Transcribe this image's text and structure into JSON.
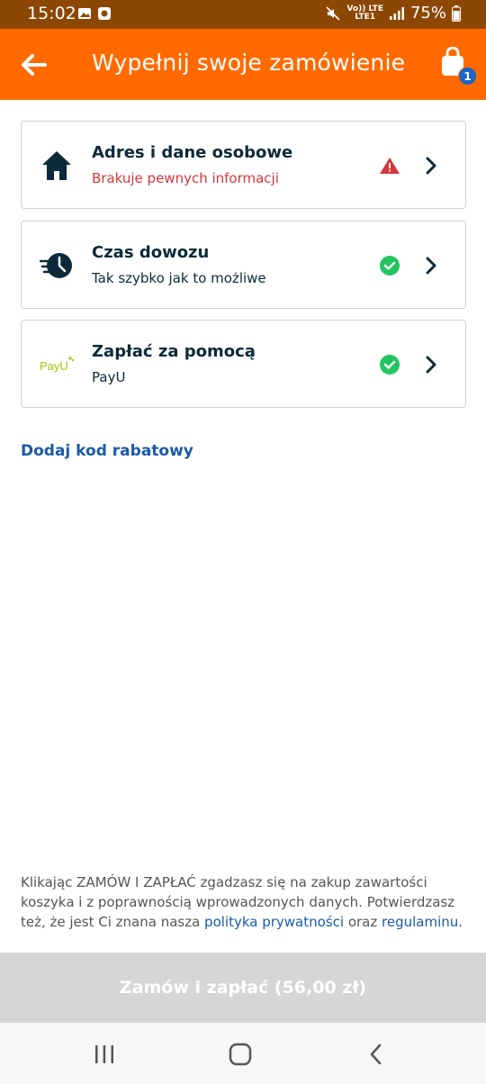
{
  "status_bar": {
    "time": "15:02",
    "network_top": "Vo)) LTE",
    "network_bottom": "LTE1",
    "battery": "75%"
  },
  "app_bar": {
    "title": "Wypełnij swoje zamówienie",
    "cart_count": "1"
  },
  "sections": [
    {
      "title": "Adres i dane osobowe",
      "subtitle": "Brakuje pewnych informacji",
      "icon": "house-icon",
      "status": "warning"
    },
    {
      "title": "Czas dowozu",
      "subtitle": "Tak szybko jak to możliwe",
      "icon": "delivery-clock-icon",
      "status": "complete"
    },
    {
      "title": "Zapłać za pomocą",
      "subtitle": "PayU",
      "icon": "payu-logo",
      "logo_text": "PayU",
      "status": "complete"
    }
  ],
  "discount_link": "Dodaj kod rabatowy",
  "terms": {
    "text_before": "Klikając ZAMÓW I ZAPŁAĆ zgadzasz się na zakup zawartości koszyka i z poprawnością wprowadzonych danych. Potwierdzasz też, że jest Ci znana nasza ",
    "privacy_link": "polityka prywatności",
    "text_middle": " oraz ",
    "rules_link": "regulaminu",
    "text_after": "."
  },
  "order_button": "Zamów i zapłać (56,00 zł)",
  "colors": {
    "accent": "#ff6a00",
    "status_bar": "#8d4705",
    "link": "#1a5aa8",
    "warning": "#d6373c",
    "success": "#22c55e",
    "badge": "#1b64c8"
  }
}
